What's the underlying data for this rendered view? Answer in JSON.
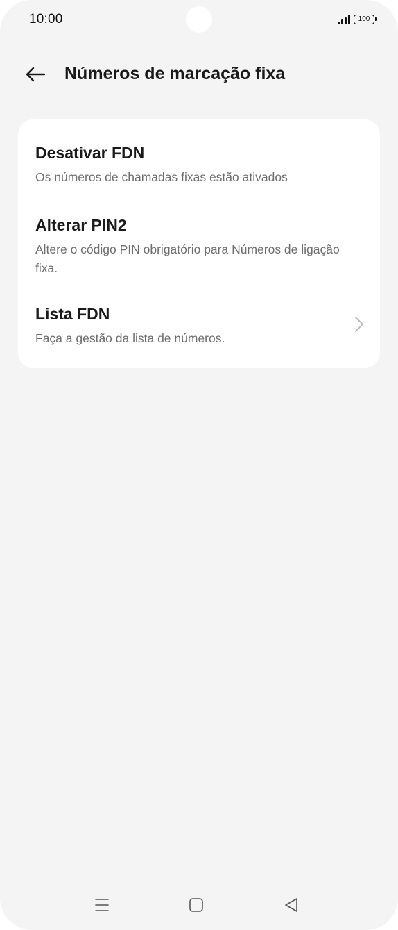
{
  "status_bar": {
    "time": "10:00",
    "battery": "100",
    "icons": [
      "signal-icon",
      "battery-icon"
    ]
  },
  "header": {
    "back_icon": "arrow-left-icon",
    "title": "Números de marcação fixa"
  },
  "settings": {
    "items": [
      {
        "title": "Desativar FDN",
        "subtitle": "Os números de chamadas fixas estão ativados"
      },
      {
        "title": "Alterar PIN2",
        "subtitle": "Altere o código PIN obrigatório para Números de ligação fixa."
      },
      {
        "title": "Lista FDN",
        "subtitle": "Faça a gestão da lista de números.",
        "icon": "chevron-right-icon"
      }
    ]
  },
  "nav_bar": {
    "icons": [
      "menu-icon",
      "home-icon",
      "back-triangle-icon"
    ]
  },
  "colors": {
    "background": "#f4f4f4",
    "card": "#ffffff",
    "title_text": "#1a1a1a",
    "subtitle_text": "#6e6e6e"
  }
}
